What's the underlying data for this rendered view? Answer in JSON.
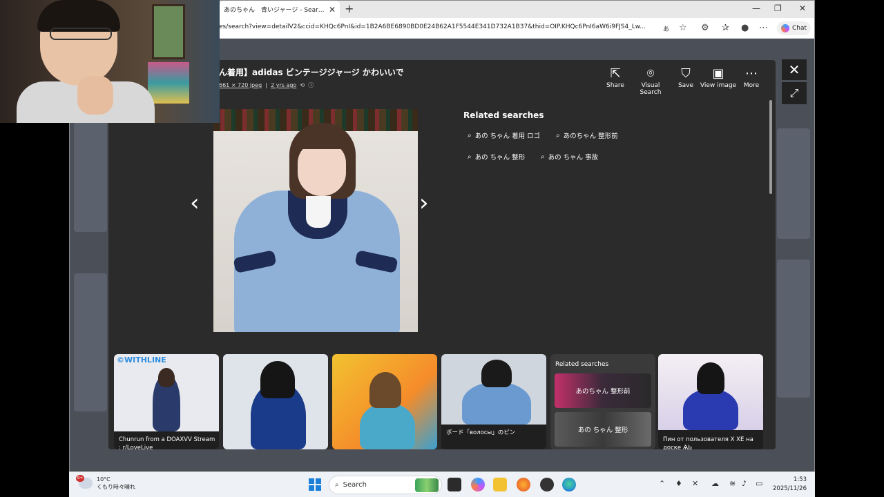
{
  "browser": {
    "tab_title": "あのちゃん　青いジャージ - Search Im",
    "new_tab": "+",
    "url": "es/search?view=detailV2&ccid=KHQc6PnI&id=1B2A6BE6890BD0E24B62A1F5544E341D732A1B37&thid=OIP.KHQc6PnI6aW6i9FJS4_Lw...",
    "ime_indicator": "あ",
    "chat_label": "Chat",
    "window_controls": [
      "—",
      "❐",
      "✕"
    ]
  },
  "viewer": {
    "title": "ん着用】adidas ビンテージジャージ かわいいで",
    "meta_size": "661 × 720 jpeg",
    "meta_sep": "|",
    "meta_age": "2 yrs ago",
    "actions": [
      {
        "label": "Share",
        "icon": "share-icon"
      },
      {
        "label": "Visual Search",
        "icon": "visual-search-icon"
      },
      {
        "label": "Save",
        "icon": "save-icon"
      },
      {
        "label": "View image",
        "icon": "view-image-icon"
      },
      {
        "label": "More",
        "icon": "more-icon"
      }
    ],
    "related_title": "Related searches",
    "related_chips": [
      "あの ちゃん 着用 ロゴ",
      "あのちゃん 整形前",
      "あの ちゃん 整形",
      "あの ちゃん 事故"
    ],
    "strip": {
      "cards": [
        {
          "caption": "Chunrun from a DOAXVV Stream : r/LoveLive",
          "badge": "©WITHLINE"
        },
        {
          "caption": ""
        },
        {
          "caption": ""
        },
        {
          "caption": "ボード「волосы」のピン"
        },
        {
          "caption": "Пин от пользователя X XE на доске ѦЬ"
        }
      ],
      "related_card": {
        "title": "Related searches",
        "tiles": [
          "あのちゃん 整形前",
          "あの ちゃん 整形"
        ]
      }
    }
  },
  "taskbar": {
    "weather_temp": "10°C",
    "weather_desc": "くもり時々晴れ",
    "weather_badge": "9+",
    "search_label": "Search",
    "time": "1:53",
    "date": "2025/11/26"
  },
  "colors": {
    "viewer_bg": "#2b2b2b",
    "taskbar_bg": "#eef1f6",
    "accent": "#1a7fd8"
  }
}
